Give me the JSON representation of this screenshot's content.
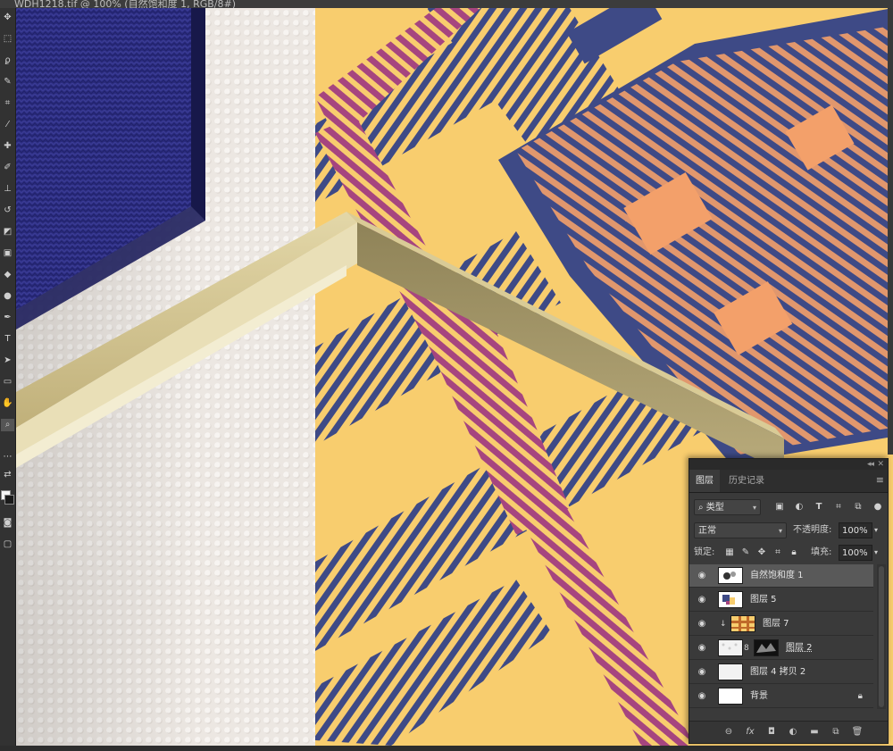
{
  "window": {
    "document_tab": "WDH1218.tif @ 100% (自然饱和度 1, RGB/8#)"
  },
  "toolbar": {
    "tools": [
      "move-tool",
      "marquee-tool",
      "lasso-tool",
      "quick-select-tool",
      "crop-tool",
      "eyedropper-tool",
      "healing-tool",
      "brush-tool",
      "stamp-tool",
      "history-brush-tool",
      "eraser-tool",
      "gradient-tool",
      "blur-tool",
      "dodge-tool",
      "pen-tool",
      "type-tool",
      "path-select-tool",
      "shape-tool",
      "hand-tool",
      "zoom-tool"
    ],
    "foreground_color": "#f5f5f5",
    "background_color": "#1a1a1a"
  },
  "canvas": {
    "colors": {
      "blue_pad": "#2a2a7a",
      "wall": "#ece7e2",
      "plaid_yellow": "#f8cd6e",
      "plaid_navy": "#3e4a86",
      "plaid_peach": "#f3a06a",
      "plaid_magenta": "#a6457f",
      "frame_gold": "#cfc08e"
    }
  },
  "layers_panel": {
    "dock_arrows": "◂◂",
    "dock_close": "✕",
    "tabs": [
      {
        "label": "图层",
        "active": true
      },
      {
        "label": "历史记录",
        "active": false
      }
    ],
    "filter": {
      "kind_label": "类型",
      "icons": [
        "image-filter-icon",
        "adjustment-filter-icon",
        "type-filter-icon",
        "shape-filter-icon",
        "smart-object-filter-icon"
      ]
    },
    "blend_mode": "正常",
    "opacity_label": "不透明度:",
    "opacity_value": "100%",
    "lock_label": "锁定:",
    "fill_label": "填充:",
    "fill_value": "100%",
    "layers": [
      {
        "name": "自然饱和度 1",
        "selected": true,
        "locked": false
      },
      {
        "name": "图层 5",
        "selected": false,
        "locked": false
      },
      {
        "name": "图层 7",
        "selected": false,
        "locked": false,
        "clipped": true
      },
      {
        "name": "图层 2",
        "selected": false,
        "locked": false,
        "has_mask": true
      },
      {
        "name": "图层 4 拷贝 2",
        "selected": false,
        "locked": false
      },
      {
        "name": "背景",
        "selected": false,
        "locked": true
      }
    ],
    "footer_icons": [
      "link-layers-icon",
      "fx-icon",
      "add-mask-icon",
      "adjustment-layer-icon",
      "group-icon",
      "new-layer-icon",
      "delete-layer-icon"
    ]
  }
}
